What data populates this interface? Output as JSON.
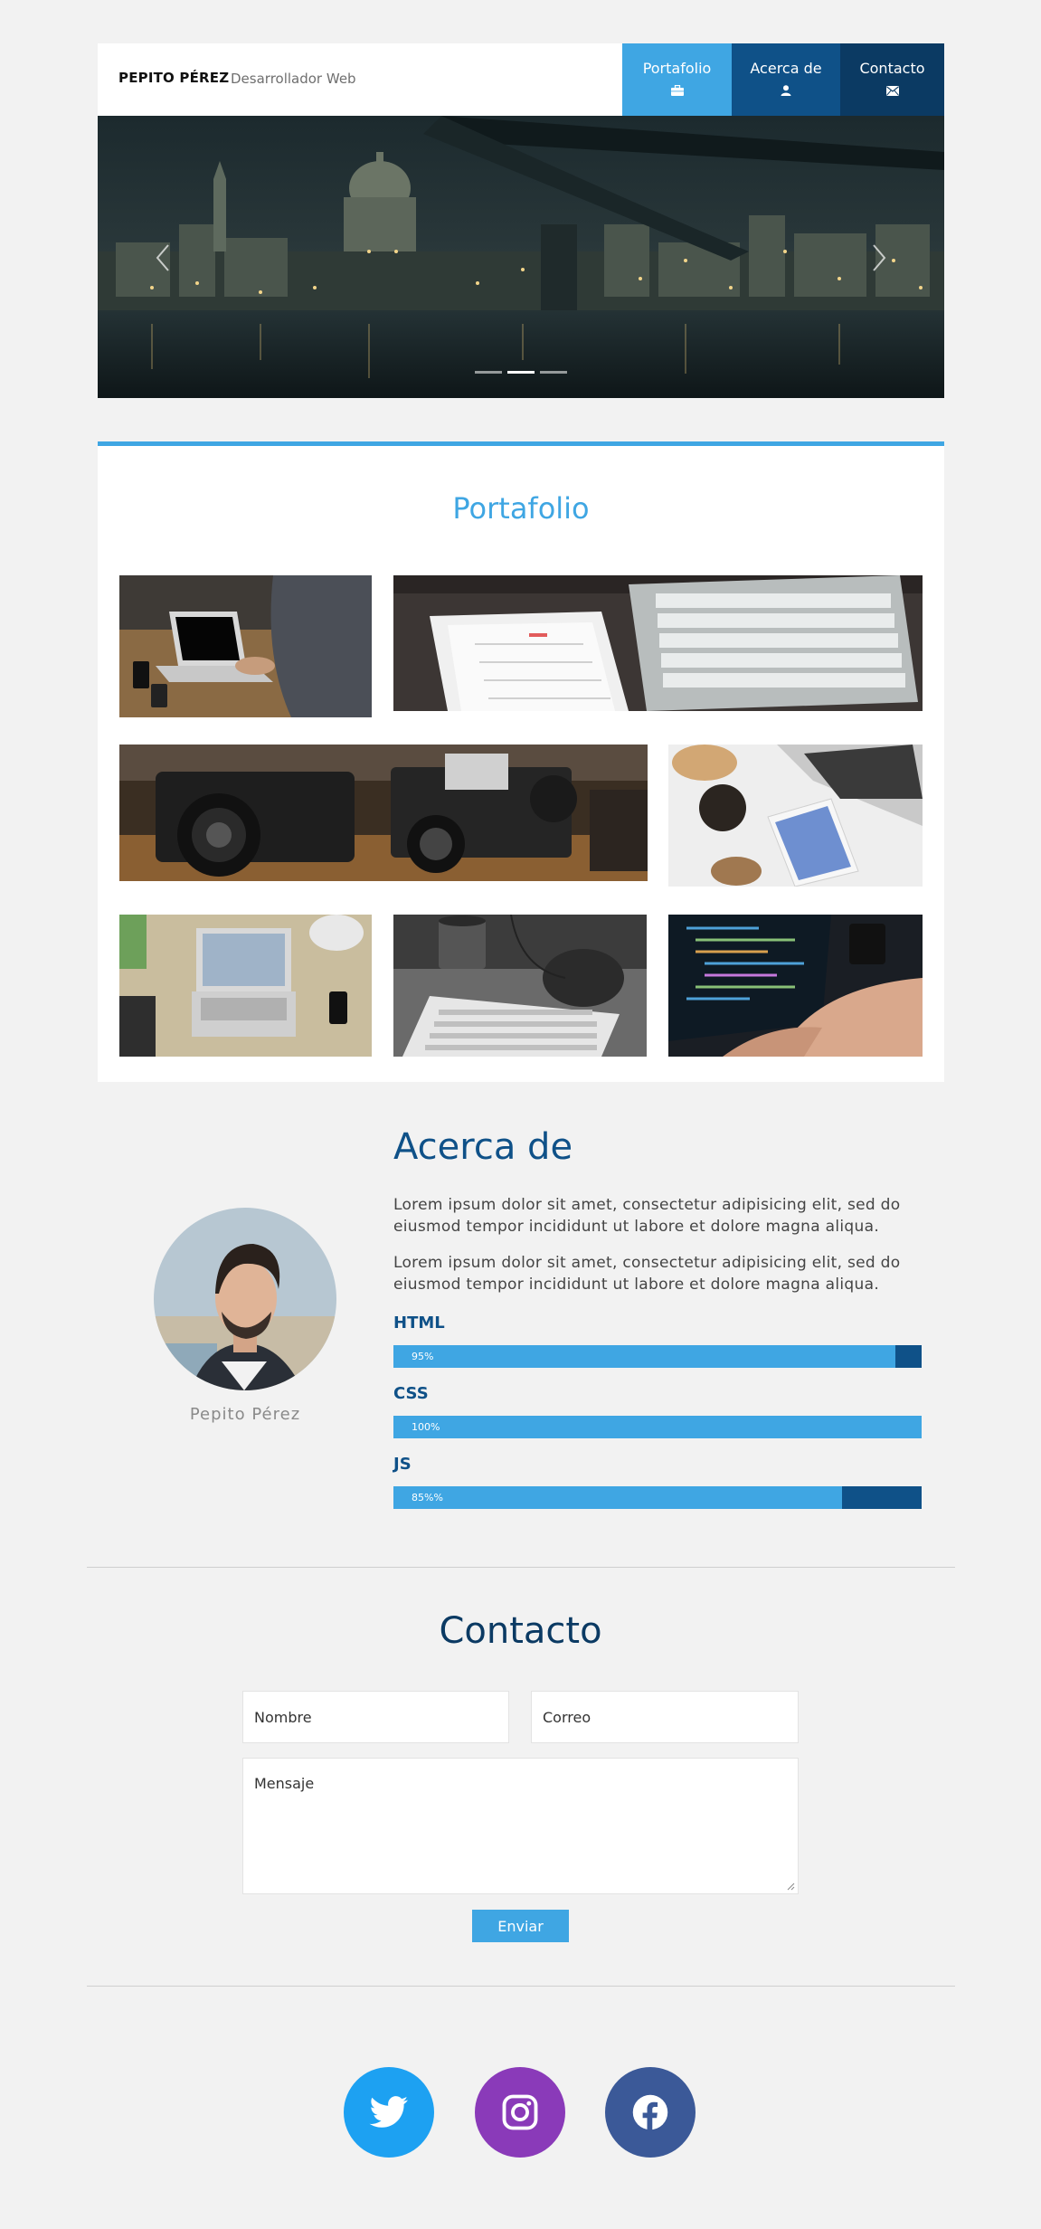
{
  "header": {
    "brand": "PEPITO PÉREZ",
    "tagline": "Desarrollador Web",
    "nav": [
      {
        "label": "Portafolio",
        "icon": "briefcase-icon",
        "color": "#3fa6e3"
      },
      {
        "label": "Acerca de",
        "icon": "user-icon",
        "color": "#0f5188"
      },
      {
        "label": "Contacto",
        "icon": "envelope-icon",
        "color": "#0b3a63"
      }
    ]
  },
  "hero": {
    "image": "london-night-skyline",
    "slides": 3,
    "active_slide": 2
  },
  "portfolio": {
    "title": "Portafolio",
    "items": [
      {
        "image": "laptop-on-desk"
      },
      {
        "image": "tablet-calendar-and-keyboard"
      },
      {
        "image": "vintage-cameras"
      },
      {
        "image": "coffee-laptop-phone"
      },
      {
        "image": "laptop-on-table"
      },
      {
        "image": "mug-and-keyboard"
      },
      {
        "image": "coding-on-laptop"
      }
    ]
  },
  "about": {
    "title": "Acerca de",
    "name": "Pepito Pérez",
    "paragraphs": [
      "Lorem ipsum dolor sit amet, consectetur adipisicing elit, sed do eiusmod tempor incididunt ut labore et dolore magna aliqua.",
      "Lorem ipsum dolor sit amet, consectetur adipisicing elit, sed do eiusmod tempor incididunt ut labore et dolore magna aliqua."
    ],
    "skills": [
      {
        "name": "HTML",
        "label": "95%",
        "percent": 95
      },
      {
        "name": "CSS",
        "label": "100%",
        "percent": 100
      },
      {
        "name": "JS",
        "label": "85%%",
        "percent": 85
      }
    ]
  },
  "contact": {
    "title": "Contacto",
    "name_placeholder": "Nombre",
    "email_placeholder": "Correo",
    "message_placeholder": "Mensaje",
    "submit_label": "Enviar"
  },
  "social": [
    {
      "icon": "twitter-icon",
      "color": "#1da1f2"
    },
    {
      "icon": "instagram-icon",
      "color": "#8a3ab9"
    },
    {
      "icon": "facebook-icon",
      "color": "#3b5998"
    }
  ]
}
